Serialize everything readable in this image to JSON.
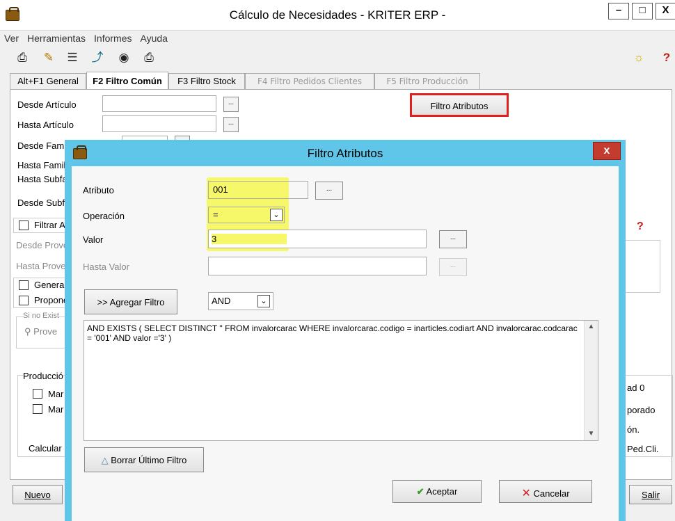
{
  "window": {
    "title": "Cálculo de Necesidades - KRITER ERP -",
    "minimize": "–",
    "maximize": "□",
    "close": "X"
  },
  "menu": [
    "Ver",
    "Herramientas",
    "Informes",
    "Ayuda"
  ],
  "toolbar_icons": [
    "print-icon",
    "pencil-icon",
    "list-icon",
    "import-icon",
    "eye-icon",
    "print-preview-icon"
  ],
  "tabs": [
    {
      "label": "Alt+F1 General",
      "state": "normal"
    },
    {
      "label": "F2 Filtro Común",
      "state": "active"
    },
    {
      "label": "F3 Filtro Stock",
      "state": "normal"
    },
    {
      "label": "F4 Filtro Pedidos Clientes",
      "state": "disabled"
    },
    {
      "label": "F5 Filtro Producción",
      "state": "disabled"
    }
  ],
  "form": {
    "desde_articulo": "Desde Artículo",
    "hasta_articulo": "Hasta Artículo",
    "desde_familia": "Desde Famil",
    "hasta_familia": "Hasta Famil",
    "hasta_subfamilia": "Hasta Subfa",
    "desde_subfamilia": "Desde Subf",
    "filtrar": "Filtrar A",
    "desde_proveedor": "Desde Prove",
    "hasta_proveedor": "Hasta Prove",
    "generar": "Generar",
    "proponer": "Propone",
    "si_no_existe": "Si no Exist",
    "prove_btn": "Prove",
    "produccion": "Producció",
    "marcar1": "Mar",
    "marcar2": "Mar",
    "calcular": "Calcular",
    "right_labels": [
      "ad 0",
      "porado",
      "ón.",
      "Ped.Cli."
    ],
    "ellipsis": "..."
  },
  "filtro_atributos_button": "Filtro Atributos",
  "bottom": {
    "nuevo": "Nuevo",
    "salir": "Salir"
  },
  "dialog": {
    "title": "Filtro Atributos",
    "close": "x",
    "atributo_label": "Atributo",
    "atributo_value": "001",
    "operacion_label": "Operación",
    "operacion_value": "=",
    "valor_label": "Valor",
    "valor_value": "3",
    "hasta_valor_label": "Hasta Valor",
    "hasta_valor_value": "",
    "ellipsis": "...",
    "agregar_filtro": ">> Agregar Filtro",
    "logic_value": "AND",
    "query_text": "AND EXISTS ( SELECT DISTINCT '' FROM invalorcarac WHERE invalorcarac.codigo = inarticles.codiart AND invalorcarac.codcarac = '001'  AND valor ='3'   )",
    "borrar": "Borrar Último Filtro",
    "aceptar": "Aceptar",
    "cancelar": "Cancelar"
  },
  "colors": {
    "dialog_frame": "#5fc6ea",
    "highlight": "#f7f76a",
    "red_box": "#e02020",
    "close_red": "#c43c2f"
  }
}
